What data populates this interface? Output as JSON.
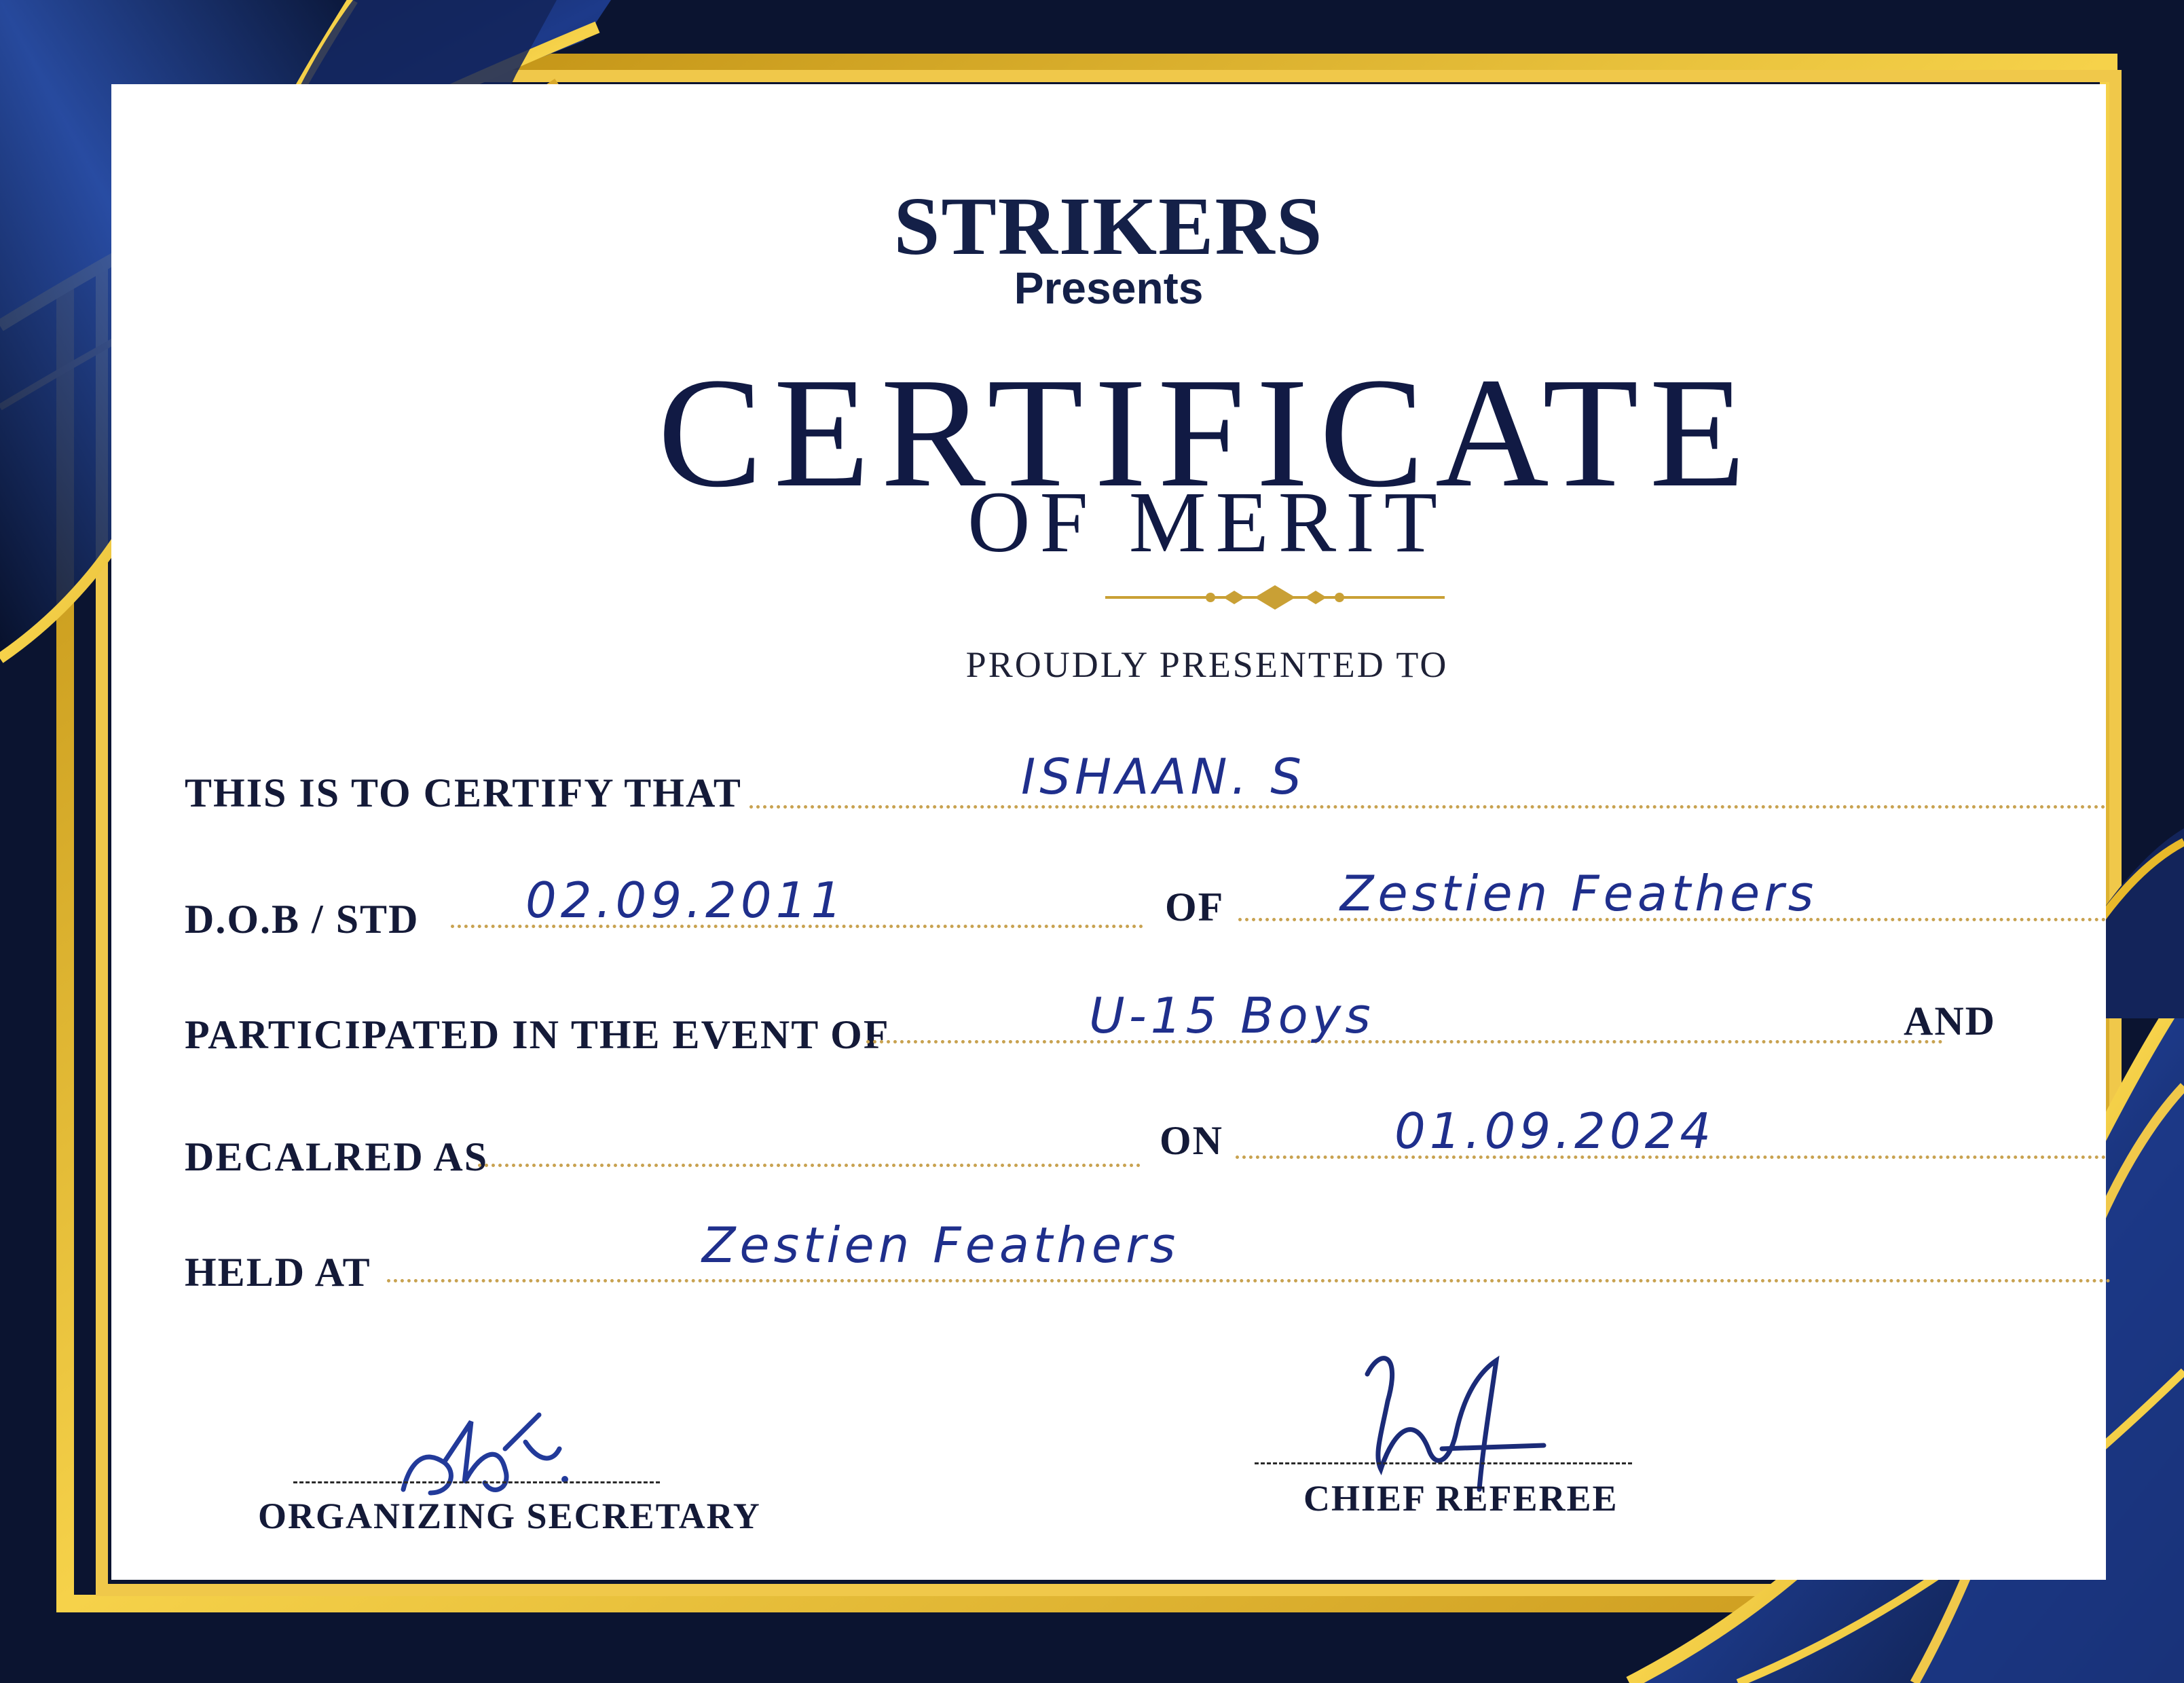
{
  "header": {
    "brand": "STRIKERS",
    "presents": "Presents",
    "title": "CERTIFICATE",
    "subtitle": "OF MERIT",
    "presented_to": "PROUDLY PRESENTED TO"
  },
  "fields": {
    "certify_label": "THIS IS TO CERTIFY THAT",
    "certify_value": "ISHAAN. S",
    "dob_label": "D.O.B / STD",
    "dob_value": "02.09.2011",
    "of_label": "OF",
    "of_value": "Zestien Feathers",
    "event_label": "PARTICIPATED IN THE EVENT OF",
    "event_value": "U-15 Boys",
    "and_label": "AND",
    "declared_label": "DECALRED AS",
    "declared_value": "",
    "on_label": "ON",
    "on_value": "01.09.2024",
    "held_label": "HELD AT",
    "held_value": "Zestien Feathers"
  },
  "signatures": {
    "left_caption": "ORGANIZING SECRETARY",
    "right_caption": "CHIEF REFEREE"
  },
  "colors": {
    "navy": "#0b1430",
    "royal_blue": "#1e3d8f",
    "gold": "#e8b92a",
    "ink_blue": "#1f2f8c"
  }
}
